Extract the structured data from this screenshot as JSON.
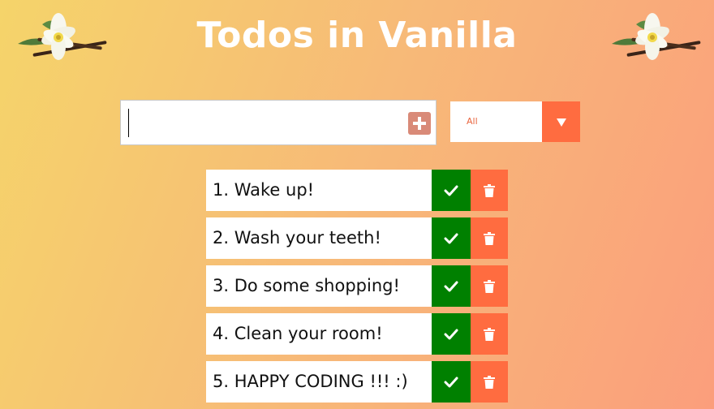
{
  "header": {
    "title": "Todos in Vanilla"
  },
  "form": {
    "input_value": "",
    "filter_selected": "All"
  },
  "todos": [
    {
      "text": "1. Wake up!"
    },
    {
      "text": "2. Wash your teeth!"
    },
    {
      "text": "3. Do some shopping!"
    },
    {
      "text": "4. Clean your room!"
    },
    {
      "text": "5. HAPPY CODING !!! :)"
    }
  ],
  "icons": {
    "flower": "vanilla-flower-icon",
    "add": "plus-square-icon",
    "dropdown": "caret-down-icon",
    "complete": "check-icon",
    "delete": "trash-icon"
  },
  "colors": {
    "complete": "#008000",
    "delete": "#ff6c40",
    "add": "#d98a78"
  }
}
